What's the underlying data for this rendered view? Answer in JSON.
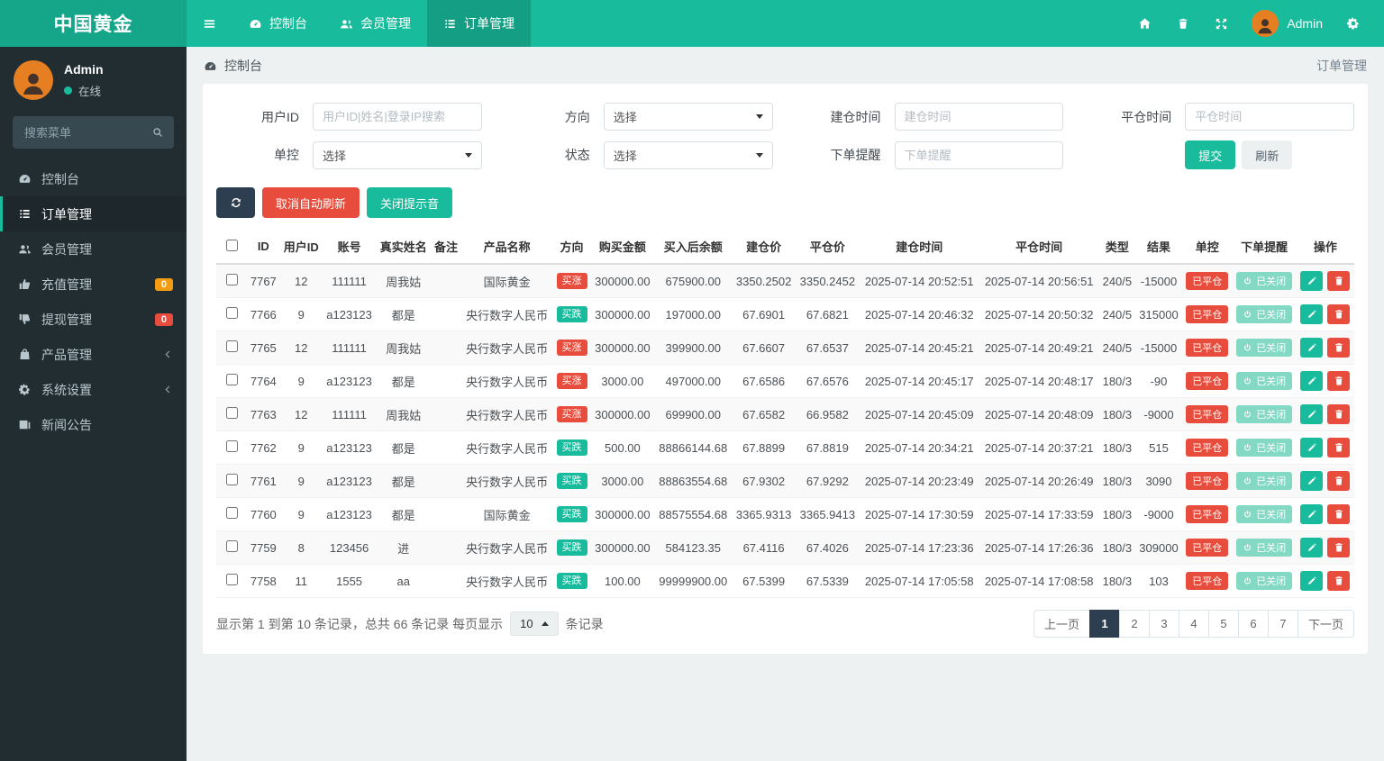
{
  "brand": {
    "title": "中国黄金"
  },
  "topnav": {
    "items": [
      {
        "label": "控制台",
        "icon": "dashboard-icon",
        "active": false
      },
      {
        "label": "会员管理",
        "icon": "users-icon",
        "active": false
      },
      {
        "label": "订单管理",
        "icon": "list-icon",
        "active": true
      }
    ],
    "user_name": "Admin"
  },
  "sidebar": {
    "user": {
      "name": "Admin",
      "status": "在线"
    },
    "search_placeholder": "搜索菜单",
    "items": [
      {
        "label": "控制台",
        "icon": "dashboard-icon",
        "active": false
      },
      {
        "label": "订单管理",
        "icon": "list-icon",
        "active": true
      },
      {
        "label": "会员管理",
        "icon": "users-icon",
        "active": false
      },
      {
        "label": "充值管理",
        "icon": "thumbs-up-icon",
        "active": false,
        "badge": "0",
        "badge_color": "#f39c12"
      },
      {
        "label": "提现管理",
        "icon": "thumbs-down-icon",
        "active": false,
        "badge": "0",
        "badge_color": "#e74c3c"
      },
      {
        "label": "产品管理",
        "icon": "bag-icon",
        "active": false,
        "chevron": true
      },
      {
        "label": "系统设置",
        "icon": "cogs-icon",
        "active": false,
        "chevron": true
      },
      {
        "label": "新闻公告",
        "icon": "news-icon",
        "active": false
      }
    ]
  },
  "breadcrumb": {
    "left": "控制台",
    "right": "订单管理"
  },
  "filters": {
    "user_id": {
      "label": "用户ID",
      "placeholder": "用户ID|姓名|登录IP搜索"
    },
    "direction": {
      "label": "方向",
      "value": "选择"
    },
    "open_time": {
      "label": "建仓时间",
      "placeholder": "建仓时间"
    },
    "close_time": {
      "label": "平仓时间",
      "placeholder": "平仓时间"
    },
    "control": {
      "label": "单控",
      "value": "选择"
    },
    "status": {
      "label": "状态",
      "value": "选择"
    },
    "order_notice": {
      "label": "下单提醒",
      "placeholder": "下单提醒"
    },
    "submit_label": "提交",
    "refresh_label": "刷新"
  },
  "toolbar": {
    "cancel_auto_refresh": "取消自动刷新",
    "close_sound": "关闭提示音"
  },
  "table": {
    "columns": [
      "ID",
      "用户ID",
      "账号",
      "真实姓名",
      "备注",
      "产品名称",
      "方向",
      "购买金额",
      "买入后余额",
      "建仓价",
      "平仓价",
      "建仓时间",
      "平仓时间",
      "类型",
      "结果",
      "单控",
      "下单提醒",
      "操作"
    ],
    "direction_labels": {
      "up": "买涨",
      "down": "买跌"
    },
    "control_label": "已平仓",
    "notice_label": "已关闭",
    "rows": [
      {
        "id": "7767",
        "uid": "12",
        "account": "111111",
        "name": "周我姑",
        "note": "",
        "product": "国际黄金",
        "dir": "up",
        "amount": "300000.00",
        "balance": "675900.00",
        "open_price": "3350.2502",
        "close_price": "3350.2452",
        "open_time": "2025-07-14 20:52:51",
        "close_time": "2025-07-14 20:56:51",
        "type": "240/5",
        "result": "-15000"
      },
      {
        "id": "7766",
        "uid": "9",
        "account": "a123123",
        "name": "都是",
        "note": "",
        "product": "央行数字人民币",
        "dir": "down",
        "amount": "300000.00",
        "balance": "197000.00",
        "open_price": "67.6901",
        "close_price": "67.6821",
        "open_time": "2025-07-14 20:46:32",
        "close_time": "2025-07-14 20:50:32",
        "type": "240/5",
        "result": "315000"
      },
      {
        "id": "7765",
        "uid": "12",
        "account": "111111",
        "name": "周我姑",
        "note": "",
        "product": "央行数字人民币",
        "dir": "up",
        "amount": "300000.00",
        "balance": "399900.00",
        "open_price": "67.6607",
        "close_price": "67.6537",
        "open_time": "2025-07-14 20:45:21",
        "close_time": "2025-07-14 20:49:21",
        "type": "240/5",
        "result": "-15000"
      },
      {
        "id": "7764",
        "uid": "9",
        "account": "a123123",
        "name": "都是",
        "note": "",
        "product": "央行数字人民币",
        "dir": "up",
        "amount": "3000.00",
        "balance": "497000.00",
        "open_price": "67.6586",
        "close_price": "67.6576",
        "open_time": "2025-07-14 20:45:17",
        "close_time": "2025-07-14 20:48:17",
        "type": "180/3",
        "result": "-90"
      },
      {
        "id": "7763",
        "uid": "12",
        "account": "111111",
        "name": "周我姑",
        "note": "",
        "product": "央行数字人民币",
        "dir": "up",
        "amount": "300000.00",
        "balance": "699900.00",
        "open_price": "67.6582",
        "close_price": "66.9582",
        "open_time": "2025-07-14 20:45:09",
        "close_time": "2025-07-14 20:48:09",
        "type": "180/3",
        "result": "-9000"
      },
      {
        "id": "7762",
        "uid": "9",
        "account": "a123123",
        "name": "都是",
        "note": "",
        "product": "央行数字人民币",
        "dir": "down",
        "amount": "500.00",
        "balance": "88866144.68",
        "open_price": "67.8899",
        "close_price": "67.8819",
        "open_time": "2025-07-14 20:34:21",
        "close_time": "2025-07-14 20:37:21",
        "type": "180/3",
        "result": "515"
      },
      {
        "id": "7761",
        "uid": "9",
        "account": "a123123",
        "name": "都是",
        "note": "",
        "product": "央行数字人民币",
        "dir": "down",
        "amount": "3000.00",
        "balance": "88863554.68",
        "open_price": "67.9302",
        "close_price": "67.9292",
        "open_time": "2025-07-14 20:23:49",
        "close_time": "2025-07-14 20:26:49",
        "type": "180/3",
        "result": "3090"
      },
      {
        "id": "7760",
        "uid": "9",
        "account": "a123123",
        "name": "都是",
        "note": "",
        "product": "国际黄金",
        "dir": "down",
        "amount": "300000.00",
        "balance": "88575554.68",
        "open_price": "3365.9313",
        "close_price": "3365.9413",
        "open_time": "2025-07-14 17:30:59",
        "close_time": "2025-07-14 17:33:59",
        "type": "180/3",
        "result": "-9000"
      },
      {
        "id": "7759",
        "uid": "8",
        "account": "123456",
        "name": "进",
        "note": "",
        "product": "央行数字人民币",
        "dir": "down",
        "amount": "300000.00",
        "balance": "584123.35",
        "open_price": "67.4116",
        "close_price": "67.4026",
        "open_time": "2025-07-14 17:23:36",
        "close_time": "2025-07-14 17:26:36",
        "type": "180/3",
        "result": "309000"
      },
      {
        "id": "7758",
        "uid": "11",
        "account": "1555",
        "name": "aa",
        "note": "",
        "product": "央行数字人民币",
        "dir": "down",
        "amount": "100.00",
        "balance": "99999900.00",
        "open_price": "67.5399",
        "close_price": "67.5339",
        "open_time": "2025-07-14 17:05:58",
        "close_time": "2025-07-14 17:08:58",
        "type": "180/3",
        "result": "103"
      }
    ]
  },
  "pagination": {
    "info_prefix": "显示第 1 到第 10 条记录，总共 66 条记录 每页显示",
    "page_size": "10",
    "info_suffix": "条记录",
    "prev": "上一页",
    "next": "下一页",
    "pages": [
      "1",
      "2",
      "3",
      "4",
      "5",
      "6",
      "7"
    ],
    "active_page": "1"
  },
  "colors": {
    "accent_green": "#18bc9c",
    "brand_green": "#15a589",
    "danger_red": "#e74c3c",
    "warning_orange": "#f39c12",
    "navy": "#2c3e50",
    "mint_badge": "#83d9c4",
    "sidebar_bg": "#222d32"
  },
  "icons": {
    "hamburger-icon": "three horizontal bars",
    "dashboard-icon": "tachometer gauge",
    "users-icon": "two people",
    "list-icon": "bulleted list",
    "home-icon": "house",
    "trash-icon": "trash can",
    "expand-icon": "four arrows fullscreen",
    "cogs-icon": "gear",
    "search-icon": "magnifier",
    "thumbs-up-icon": "thumb up hand",
    "thumbs-down-icon": "thumb down hand",
    "bag-icon": "shopping bag",
    "news-icon": "newspaper",
    "chevron-left-icon": "left angle bracket",
    "refresh-icon": "circular arrows",
    "pencil-icon": "pencil",
    "power-icon": "power circle",
    "person-icon": "person silhouette"
  }
}
